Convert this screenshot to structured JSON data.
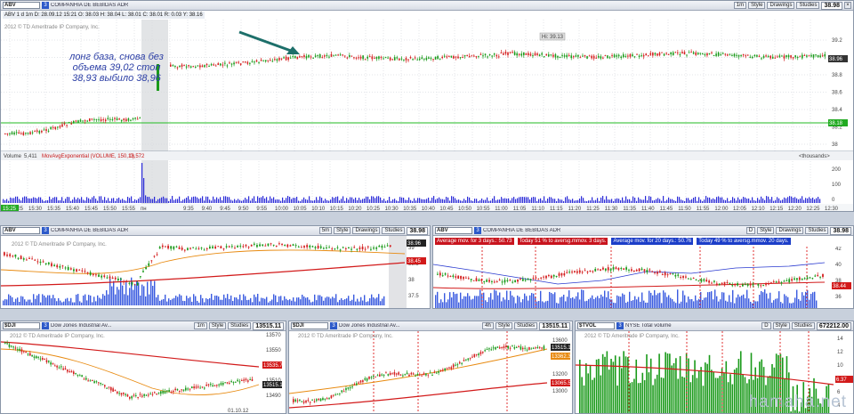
{
  "main": {
    "symbol": "ABV",
    "desc": "COMPANHIA DE BEBIDAS ADR",
    "info": "ABV 1 d 1m  D: 28.09.12 15:21  O: 38.03  H: 38.04  L: 38.01  C: 38.01  R: 0.03  Y: 38.16",
    "copyright": "2012 © TD Ameritrade IP Company, Inc.",
    "buttons": [
      "Style",
      "Drawings",
      "Studies"
    ],
    "period": "1m",
    "price": "38.98",
    "hi_label": "Hi: 39.13",
    "last_tag": "38.96",
    "green_tag": "38.18",
    "y_ticks": [
      "39.2",
      "39",
      "38.8",
      "38.6",
      "38.4",
      "38.2",
      "38"
    ],
    "note": "лонг база, снова без объема 39,02 стоп 38,93 выбило 38,96",
    "volume_label": "Volume",
    "volume_value": "5,411",
    "volume_study": "MovAvgExponential (VOLUME, 150, 0)",
    "volume_study_value": "13,572",
    "volume_unit": "<thousands>",
    "volume_ticks": [
      "200",
      "100",
      "0"
    ],
    "time_labels": [
      "15:25",
      "15:30",
      "15:35",
      "15:40",
      "15:45",
      "15:50",
      "15:55",
      "пн",
      "9:35",
      "9:40",
      "9:45",
      "9:50",
      "9:55",
      "10:00",
      "10:05",
      "10:10",
      "10:15",
      "10:20",
      "10:25",
      "10:30",
      "10:35",
      "10:40",
      "10:45",
      "10:50",
      "10:55",
      "11:00",
      "11:05",
      "11:10",
      "11:15",
      "11:20",
      "11:25",
      "11:30",
      "11:35",
      "11:40",
      "11:45",
      "11:50",
      "11:55",
      "12:00",
      "12:05",
      "12:10",
      "12:15",
      "12:20",
      "12:25",
      "12:30"
    ],
    "date_tag": "15:25"
  },
  "mid_left": {
    "symbol": "ABV",
    "desc": "COMPANHIA DE BEBIDAS ADR",
    "period": "5m",
    "buttons": [
      "Style",
      "Drawings",
      "Studies"
    ],
    "price": "38.98",
    "tags": [
      "38.96",
      "38.45"
    ],
    "y_ticks": [
      "39",
      "38.5",
      "38",
      "37.5"
    ],
    "copyright": "2012 © TD Ameritrade IP Company, Inc."
  },
  "mid_right": {
    "symbol": "ABV",
    "desc": "COMPANHIA DE BEBIDAS ADR",
    "period": "D",
    "buttons": [
      "Style",
      "Drawings",
      "Studies"
    ],
    "price": "38.98",
    "info_boxes": [
      {
        "text": "Average mov. for 3 days.: 50.73",
        "color": "#c8141e"
      },
      {
        "text": "Today 51 % to aversg.mmov. 3 days.",
        "color": "#c8141e"
      },
      {
        "text": "Average mov. for 20 days.: 50.76",
        "color": "#1c3ec8"
      },
      {
        "text": "Today 49 % to aversg.mmov. 20 days.",
        "color": "#1c3ec8"
      }
    ],
    "y_ticks": [
      "42",
      "40",
      "38",
      "36"
    ],
    "tag": "38.44"
  },
  "bottom": [
    {
      "symbol": "$DJI",
      "desc": "Dow Jones Industrial Av...",
      "period": "1m",
      "buttons": [
        "Style",
        "Drawings",
        "Studies"
      ],
      "price": "13515.11",
      "y_ticks": [
        "13570",
        "13550",
        "13530",
        "13510",
        "13490"
      ],
      "tags": [
        "13535.74",
        "13515.11"
      ],
      "copyright": "2012 © TD Ameritrade IP Company, Inc.",
      "date": "01.10.12"
    },
    {
      "symbol": "$DJI",
      "desc": "Dow Jones Industrial Av...",
      "period": "4h",
      "buttons": [
        "Style",
        "Drawings",
        "Studies"
      ],
      "price": "13515.11",
      "y_ticks": [
        "13600",
        "13400",
        "13200",
        "13000"
      ],
      "tags": [
        "13515.11",
        "13362.37",
        "13065.58"
      ],
      "copyright": "2012 © TD Ameritrade IP Company, Inc."
    },
    {
      "symbol": "$TVOL",
      "desc": "NYSE Total volume",
      "period": "D",
      "buttons": [
        "Style",
        "Drawings",
        "Studies"
      ],
      "price": "672212.00",
      "y_ticks": [
        "14",
        "12",
        "10",
        "8",
        "6",
        "4"
      ],
      "tag": "6.37",
      "copyright": "2012 © TD Ameritrade IP Company, Inc."
    }
  ],
  "watermark": "hamaha.net"
}
